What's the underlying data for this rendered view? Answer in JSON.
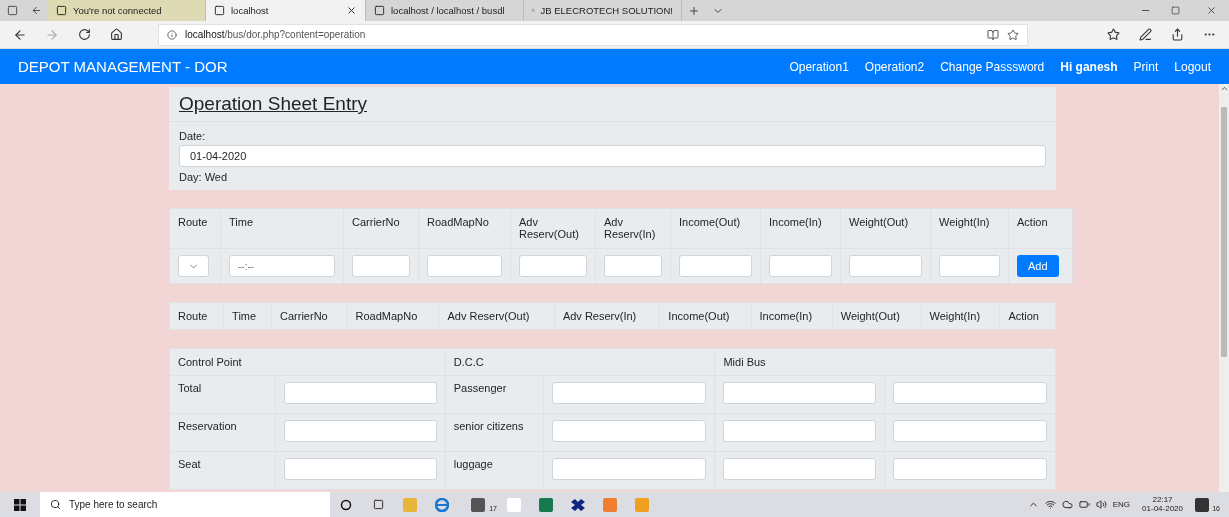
{
  "browser": {
    "tabs": [
      {
        "label": "You're not connected",
        "selected": false,
        "kind": "warning"
      },
      {
        "label": "localhost",
        "selected": true,
        "kind": "normal"
      },
      {
        "label": "localhost / localhost / busdl",
        "selected": false,
        "kind": "normal"
      },
      {
        "label": "JB ELECROTECH SOLUTION!",
        "selected": false,
        "kind": "normal"
      }
    ],
    "url_host": "localhost",
    "url_path": "/bus/dor.php?content=operation"
  },
  "navbar": {
    "brand": "DEPOT MANAGEMENT - DOR",
    "links": [
      {
        "label": "Operation1",
        "kind": "link"
      },
      {
        "label": "Operation2",
        "kind": "link"
      },
      {
        "label": "Change Passsword",
        "kind": "link"
      },
      {
        "label": "Hi ganesh",
        "kind": "user"
      },
      {
        "label": "Print",
        "kind": "link"
      },
      {
        "label": "Logout",
        "kind": "link"
      }
    ]
  },
  "sheet": {
    "title": "Operation Sheet Entry",
    "date_label": "Date:",
    "date_value": "01-04-2020",
    "day": "Day: Wed"
  },
  "entry_table": {
    "columns": [
      "Route",
      "Time",
      "CarrierNo",
      "RoadMapNo",
      "Adv Reserv(Out)",
      "Adv Reserv(In)",
      "Income(Out)",
      "Income(In)",
      "Weight(Out)",
      "Weight(In)",
      "Action"
    ],
    "time_placeholder": "--:--",
    "button": "Add"
  },
  "list_table": {
    "columns": [
      "Route",
      "Time",
      "CarrierNo",
      "RoadMapNo",
      "Adv Reserv(Out)",
      "Adv Reserv(In)",
      "Income(Out)",
      "Income(In)",
      "Weight(Out)",
      "Weight(In)",
      "Action"
    ]
  },
  "control_table": {
    "headers": [
      "Control Point",
      "D.C.C",
      "Midi Bus"
    ],
    "rows": [
      {
        "label": "Total",
        "label2": "Passenger"
      },
      {
        "label": "Reservation",
        "label2": "senior citizens"
      },
      {
        "label": "Seat",
        "label2": "luggage"
      }
    ]
  },
  "taskbar": {
    "search_placeholder": "Type here to search",
    "mail_count": "17",
    "language": "ENG",
    "time": "22:17",
    "date": "01-04-2020",
    "notification_count": "16"
  }
}
